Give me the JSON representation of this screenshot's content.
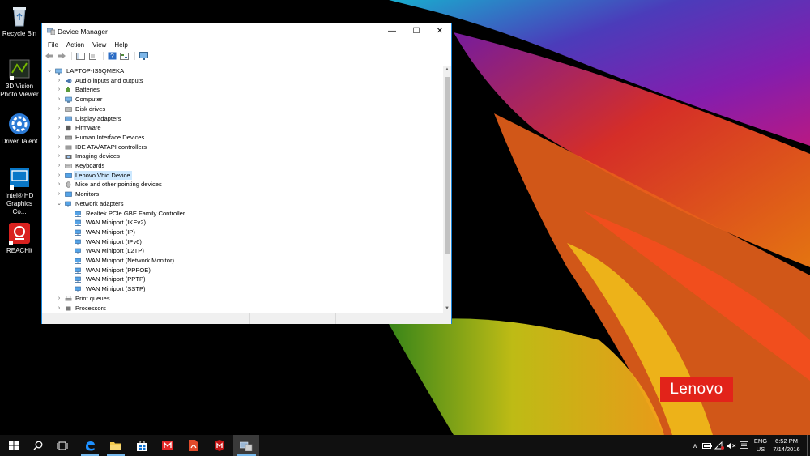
{
  "desktop": {
    "icons": [
      {
        "label": "Recycle Bin"
      },
      {
        "label": "3D Vision Photo Viewer"
      },
      {
        "label": "Driver Talent"
      },
      {
        "label": "Intel® HD Graphics Co..."
      },
      {
        "label": "REACHit"
      }
    ],
    "brand": "Lenovo"
  },
  "window": {
    "title": "Device Manager",
    "controls": {
      "minimize": "—",
      "maximize": "☐",
      "close": "✕"
    },
    "menu": [
      "File",
      "Action",
      "View",
      "Help"
    ],
    "tree": {
      "root": "LAPTOP-IS5QMEKA",
      "categories": [
        {
          "label": "Audio inputs and outputs",
          "icon": "speaker-icon"
        },
        {
          "label": "Batteries",
          "icon": "battery-icon"
        },
        {
          "label": "Computer",
          "icon": "computer-icon"
        },
        {
          "label": "Disk drives",
          "icon": "disk-icon"
        },
        {
          "label": "Display adapters",
          "icon": "display-icon"
        },
        {
          "label": "Firmware",
          "icon": "chip-icon"
        },
        {
          "label": "Human Interface Devices",
          "icon": "hid-icon"
        },
        {
          "label": "IDE ATA/ATAPI controllers",
          "icon": "ide-icon"
        },
        {
          "label": "Imaging devices",
          "icon": "camera-icon"
        },
        {
          "label": "Keyboards",
          "icon": "keyboard-icon"
        },
        {
          "label": "Lenovo Vhid Device",
          "icon": "monitor-icon",
          "selected": true
        },
        {
          "label": "Mice and other pointing devices",
          "icon": "mouse-icon"
        },
        {
          "label": "Monitors",
          "icon": "monitor-icon"
        },
        {
          "label": "Network adapters",
          "icon": "network-icon",
          "expanded": true,
          "children": [
            "Realtek PCIe GBE Family Controller",
            "WAN Miniport (IKEv2)",
            "WAN Miniport (IP)",
            "WAN Miniport (IPv6)",
            "WAN Miniport (L2TP)",
            "WAN Miniport (Network Monitor)",
            "WAN Miniport (PPPOE)",
            "WAN Miniport (PPTP)",
            "WAN Miniport (SSTP)"
          ]
        },
        {
          "label": "Print queues",
          "icon": "printer-icon"
        },
        {
          "label": "Processors",
          "icon": "cpu-icon"
        }
      ]
    }
  },
  "taskbar": {
    "lang": [
      "ENG",
      "US"
    ],
    "time": "6:52 PM",
    "date": "7/14/2016"
  },
  "colors": {
    "accent": "#1883d7",
    "selection": "#cce8ff",
    "taskbar": "#101010",
    "lenovo_red": "#e2231a"
  }
}
